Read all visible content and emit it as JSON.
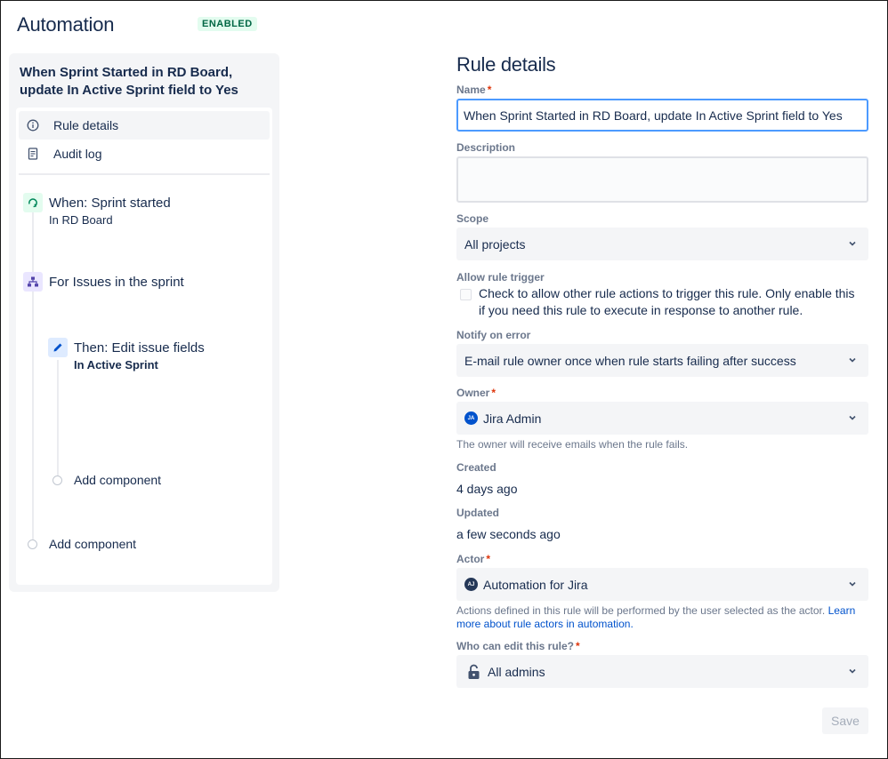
{
  "header": {
    "title": "Automation",
    "status": "ENABLED"
  },
  "sidebar": {
    "rule_name": "When Sprint Started in RD Board, update In Active Sprint field to Yes",
    "nav": [
      {
        "label": "Rule details",
        "icon": "info-icon",
        "selected": true
      },
      {
        "label": "Audit log",
        "icon": "document-icon",
        "selected": false
      }
    ],
    "components": {
      "trigger": {
        "title": "When: Sprint started",
        "subtitle_prefix": "In",
        "subtitle": "RD Board",
        "icon": "sprint-icon",
        "color": "#e3fcef"
      },
      "branch": {
        "title": "For Issues in the sprint",
        "icon": "hierarchy-icon",
        "color": "#eae6ff"
      },
      "action": {
        "title": "Then: Edit issue fields",
        "subtitle": "In Active Sprint",
        "icon": "pencil-icon",
        "color": "#deebff"
      },
      "add_inner": "Add component",
      "add_outer": "Add component"
    }
  },
  "form": {
    "title": "Rule details",
    "name": {
      "label": "Name",
      "value": "When Sprint Started in RD Board, update In Active Sprint field to Yes"
    },
    "description": {
      "label": "Description",
      "value": ""
    },
    "scope": {
      "label": "Scope",
      "value": "All projects"
    },
    "allow_trigger": {
      "label": "Allow rule trigger",
      "checkbox_text": "Check to allow other rule actions to trigger this rule. Only enable this if you need this rule to execute in response to another rule.",
      "checked": false
    },
    "notify": {
      "label": "Notify on error",
      "value": "E-mail rule owner once when rule starts failing after success"
    },
    "owner": {
      "label": "Owner",
      "value": "Jira Admin",
      "avatar": "JA",
      "avatar_color": "#0052cc",
      "helper": "The owner will receive emails when the rule fails."
    },
    "created": {
      "label": "Created",
      "value": "4 days ago"
    },
    "updated": {
      "label": "Updated",
      "value": "a few seconds ago"
    },
    "actor": {
      "label": "Actor",
      "value": "Automation for Jira",
      "avatar": "AJ",
      "avatar_color": "#253858",
      "helper": "Actions defined in this rule will be performed by the user selected as the actor.",
      "link": "Learn more about rule actors in automation."
    },
    "who_can_edit": {
      "label": "Who can edit this rule?",
      "value": "All admins",
      "icon": "unlock-icon"
    },
    "save_label": "Save"
  },
  "colors": {
    "accent": "#4c9aff",
    "required": "#de350b",
    "link": "#0052cc",
    "badge_bg": "#e3fcef",
    "badge_text": "#006644"
  }
}
